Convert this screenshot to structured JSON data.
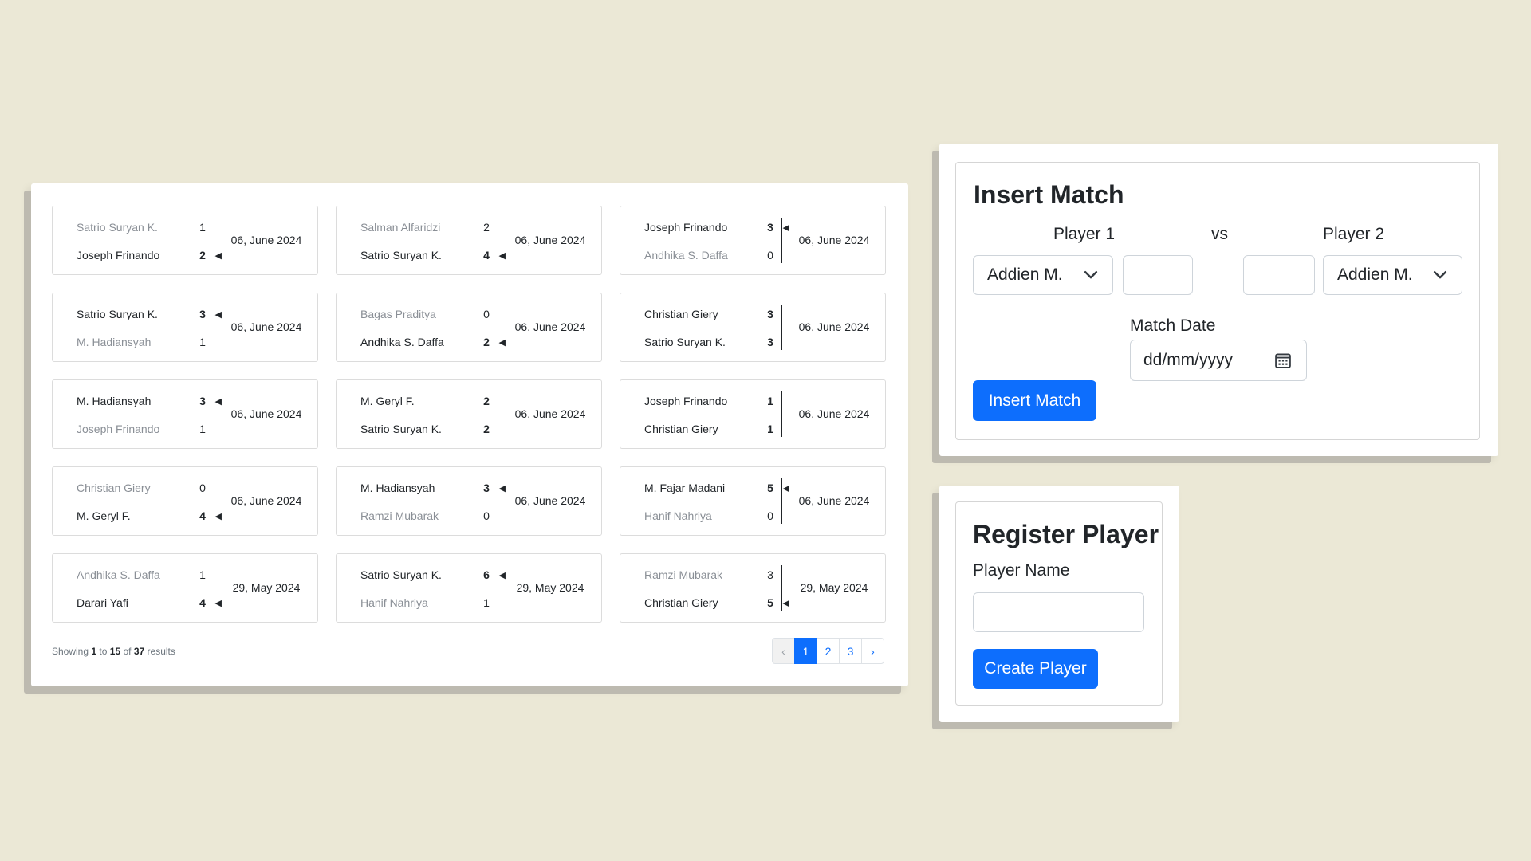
{
  "matches": [
    {
      "p1": {
        "name": "Satrio Suryan K.",
        "score": "1",
        "winner": false
      },
      "p2": {
        "name": "Joseph Frinando",
        "score": "2",
        "winner": true
      },
      "date": "06, June 2024"
    },
    {
      "p1": {
        "name": "Salman Alfaridzi",
        "score": "2",
        "winner": false
      },
      "p2": {
        "name": "Satrio Suryan K.",
        "score": "4",
        "winner": true
      },
      "date": "06, June 2024"
    },
    {
      "p1": {
        "name": "Joseph Frinando",
        "score": "3",
        "winner": true
      },
      "p2": {
        "name": "Andhika S. Daffa",
        "score": "0",
        "winner": false
      },
      "date": "06, June 2024"
    },
    {
      "p1": {
        "name": "Satrio Suryan K.",
        "score": "3",
        "winner": true
      },
      "p2": {
        "name": "M. Hadiansyah",
        "score": "1",
        "winner": false
      },
      "date": "06, June 2024"
    },
    {
      "p1": {
        "name": "Bagas Praditya",
        "score": "0",
        "winner": false
      },
      "p2": {
        "name": "Andhika S. Daffa",
        "score": "2",
        "winner": true
      },
      "date": "06, June 2024"
    },
    {
      "p1": {
        "name": "Christian Giery",
        "score": "3",
        "winner": null
      },
      "p2": {
        "name": "Satrio Suryan K.",
        "score": "3",
        "winner": null
      },
      "date": "06, June 2024"
    },
    {
      "p1": {
        "name": "M. Hadiansyah",
        "score": "3",
        "winner": true
      },
      "p2": {
        "name": "Joseph Frinando",
        "score": "1",
        "winner": false
      },
      "date": "06, June 2024"
    },
    {
      "p1": {
        "name": "M. Geryl F.",
        "score": "2",
        "winner": null
      },
      "p2": {
        "name": "Satrio Suryan K.",
        "score": "2",
        "winner": null
      },
      "date": "06, June 2024"
    },
    {
      "p1": {
        "name": "Joseph Frinando",
        "score": "1",
        "winner": null
      },
      "p2": {
        "name": "Christian Giery",
        "score": "1",
        "winner": null
      },
      "date": "06, June 2024"
    },
    {
      "p1": {
        "name": "Christian Giery",
        "score": "0",
        "winner": false
      },
      "p2": {
        "name": "M. Geryl F.",
        "score": "4",
        "winner": true
      },
      "date": "06, June 2024"
    },
    {
      "p1": {
        "name": "M. Hadiansyah",
        "score": "3",
        "winner": true
      },
      "p2": {
        "name": "Ramzi Mubarak",
        "score": "0",
        "winner": false
      },
      "date": "06, June 2024"
    },
    {
      "p1": {
        "name": "M. Fajar Madani",
        "score": "5",
        "winner": true
      },
      "p2": {
        "name": "Hanif Nahriya",
        "score": "0",
        "winner": false
      },
      "date": "06, June 2024"
    },
    {
      "p1": {
        "name": "Andhika S. Daffa",
        "score": "1",
        "winner": false
      },
      "p2": {
        "name": "Darari Yafi",
        "score": "4",
        "winner": true
      },
      "date": "29, May 2024"
    },
    {
      "p1": {
        "name": "Satrio Suryan K.",
        "score": "6",
        "winner": true
      },
      "p2": {
        "name": "Hanif Nahriya",
        "score": "1",
        "winner": false
      },
      "date": "29, May 2024"
    },
    {
      "p1": {
        "name": "Ramzi Mubarak",
        "score": "3",
        "winner": false
      },
      "p2": {
        "name": "Christian Giery",
        "score": "5",
        "winner": true
      },
      "date": "29, May 2024"
    }
  ],
  "results": {
    "prefix": "Showing",
    "from": "1",
    "to_word": "to",
    "to": "15",
    "of_word": "of",
    "total": "37",
    "suffix": "results"
  },
  "pagination": {
    "prev": "‹",
    "pages": [
      "1",
      "2",
      "3"
    ],
    "active": "1",
    "next": "›"
  },
  "insert_match": {
    "title": "Insert Match",
    "player1_label": "Player 1",
    "vs_label": "vs",
    "player2_label": "Player 2",
    "player1_selected": "Addien M.",
    "player2_selected": "Addien M.",
    "score1_value": "",
    "score2_value": "",
    "date_label": "Match Date",
    "date_placeholder": "dd/mm/yyyy",
    "button_label": "Insert Match"
  },
  "register_player": {
    "title": "Register Player",
    "name_label": "Player Name",
    "name_value": "",
    "button_label": "Create Player"
  },
  "colors": {
    "primary": "#0d6efd",
    "background": "#ebe8d6",
    "loser_text": "#8a8f96"
  }
}
